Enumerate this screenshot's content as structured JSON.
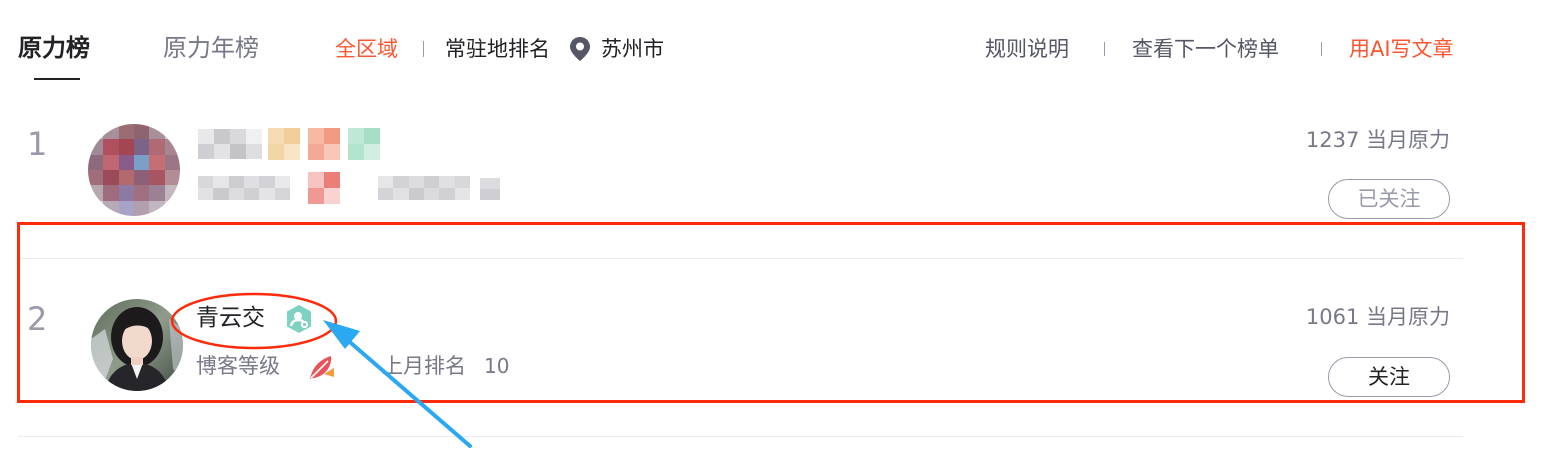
{
  "tabs": [
    {
      "label": "原力榜",
      "active": true
    },
    {
      "label": "原力年榜",
      "active": false
    }
  ],
  "filters": {
    "all_region": "全区域",
    "resident_rank": "常驻地排名",
    "city": "苏州市"
  },
  "top_links": {
    "rules": "规则说明",
    "next_board": "查看下一个榜单",
    "ai_write": "用AI写文章"
  },
  "rows": [
    {
      "rank": "1",
      "power": "1237 当月原力",
      "follow_label": "已关注",
      "followed": true,
      "blurred": true
    },
    {
      "rank": "2",
      "name": "青云交",
      "level_label": "博客等级",
      "last_month_label": "上月排名",
      "last_month_rank": "10",
      "power": "1061 当月原力",
      "follow_label": "关注",
      "followed": false
    }
  ],
  "colors": {
    "accent": "#fc5531",
    "highlight_box": "#ff2a0a",
    "arrow": "#2aa8f2",
    "verify_badge": "#7fd1c2"
  },
  "icons": {
    "location": "location-pin-icon",
    "verify": "verified-user-icon",
    "level": "blog-level-feather-icon"
  }
}
